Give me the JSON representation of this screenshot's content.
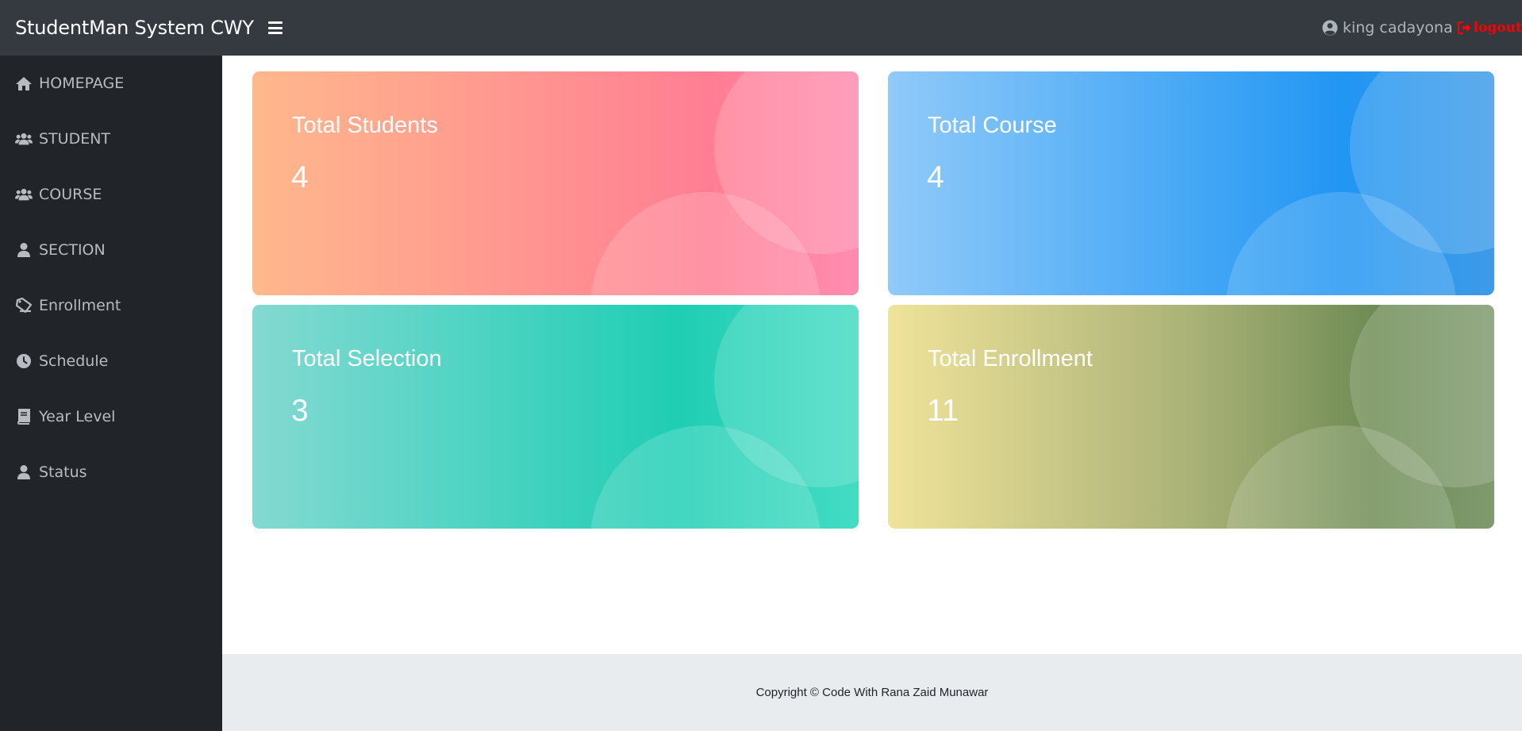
{
  "header": {
    "brand": "StudentMan System CWY",
    "menu_toggle_icon": "bars-icon",
    "user_icon": "user-circle-icon",
    "user_name": "king cadayona",
    "logout_icon": "sign-out-icon",
    "logout_label": "logout",
    "logout_color": "#ff0000"
  },
  "sidebar": {
    "items": [
      {
        "label": "HOMEPAGE",
        "icon": "home-icon"
      },
      {
        "label": "STUDENT",
        "icon": "users-icon"
      },
      {
        "label": "COURSE",
        "icon": "users-icon"
      },
      {
        "label": "SECTION",
        "icon": "user-icon"
      },
      {
        "label": "Enrollment",
        "icon": "tag-icon"
      },
      {
        "label": "Schedule",
        "icon": "clock-icon"
      },
      {
        "label": "Year Level",
        "icon": "book-icon"
      },
      {
        "label": "Status",
        "icon": "user-icon"
      }
    ]
  },
  "cards": [
    {
      "title": "Total Students",
      "value": "4"
    },
    {
      "title": "Total Course",
      "value": "4"
    },
    {
      "title": "Total Selection",
      "value": "3"
    },
    {
      "title": "Total Enrollment",
      "value": "11"
    }
  ],
  "footer": {
    "copyright": "Copyright © Code With Rana Zaid Munawar"
  },
  "colors": {
    "topbar": "#343a40",
    "sidebar": "#212529",
    "footer": "#e9ecef"
  }
}
